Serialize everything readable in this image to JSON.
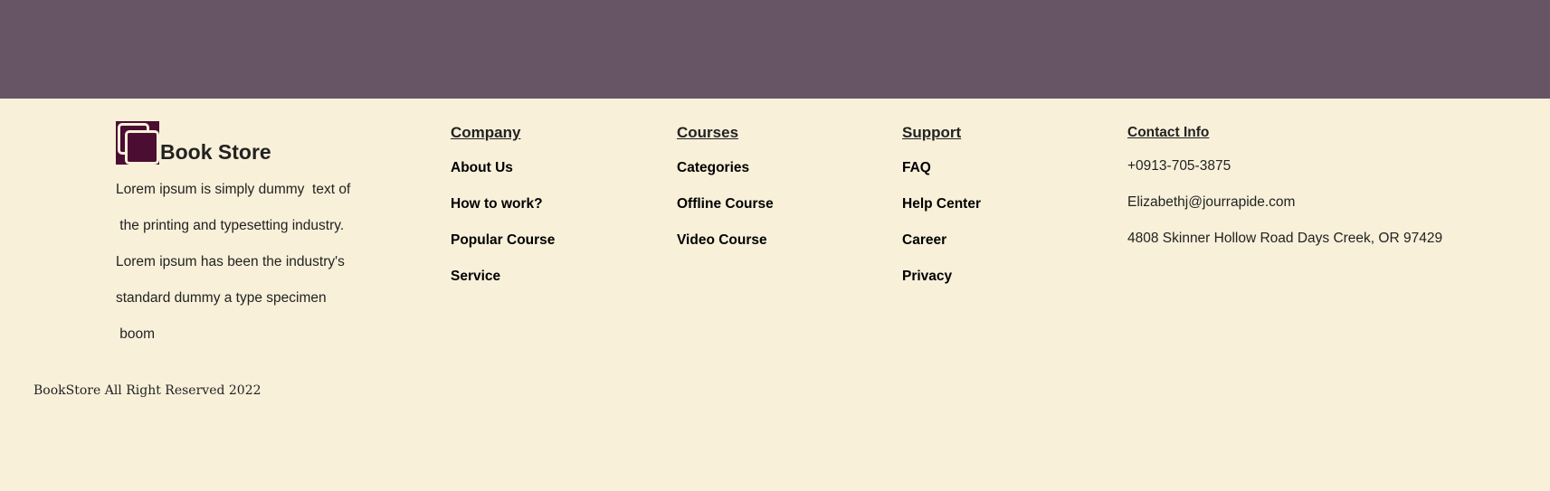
{
  "brand": {
    "name": "Book Store",
    "description": "Lorem ipsum is simply dummy  text of\n the printing and typesetting industry.\nLorem ipsum has been the industry's\nstandard dummy a type specimen\n boom",
    "logo_icon": "books-icon"
  },
  "columns": {
    "company": {
      "title": "Company",
      "links": [
        "About Us",
        "How to work?",
        "Popular Course",
        "Service"
      ]
    },
    "courses": {
      "title": "Courses",
      "links": [
        "Categories",
        "Offline Course",
        "Video Course"
      ]
    },
    "support": {
      "title": "Support",
      "links": [
        "FAQ",
        "Help Center",
        "Career",
        "Privacy"
      ]
    }
  },
  "contact": {
    "title": "Contact Info",
    "phone": "+0913-705-3875",
    "email": "Elizabethj@jourrapide.com",
    "address": "4808 Skinner Hollow Road Days Creek, OR 97429"
  },
  "copyright": "BookStore All Right Reserved 2022",
  "colors": {
    "top_band": "#675565",
    "background": "#f8f0d9",
    "logo": "#4b0d32"
  }
}
